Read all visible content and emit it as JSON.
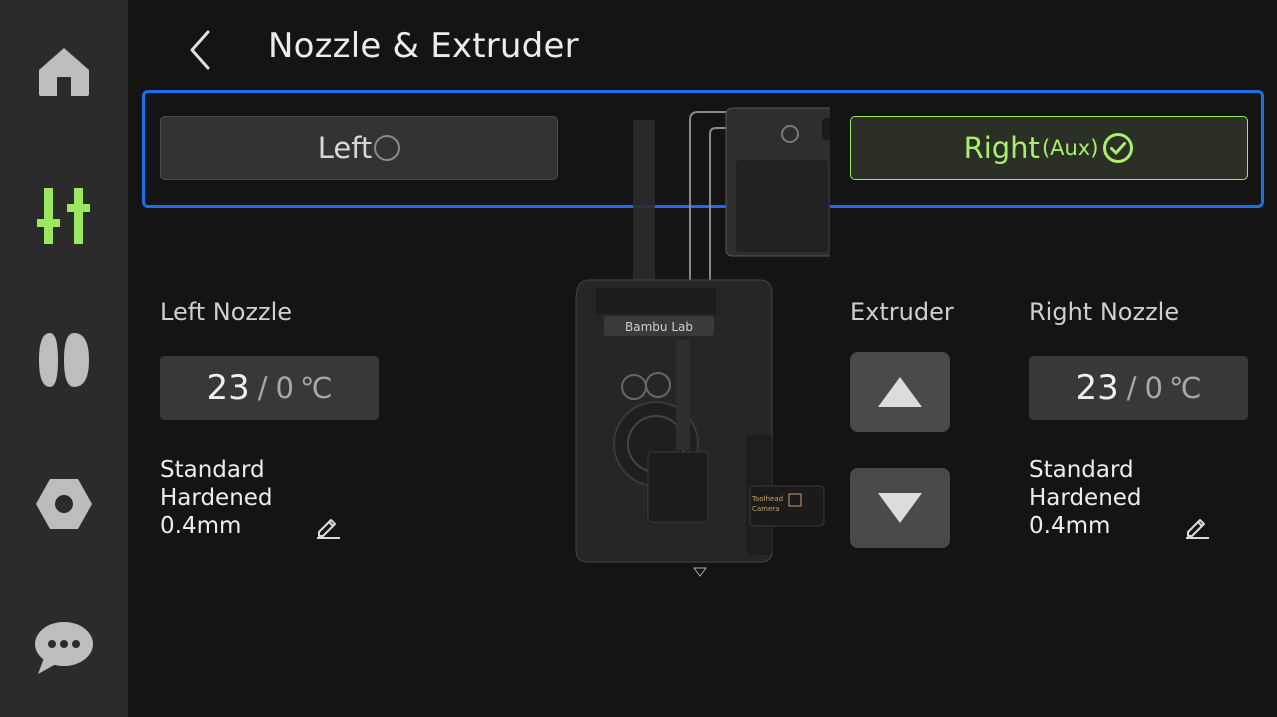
{
  "header": {
    "title": "Nozzle & Extruder"
  },
  "nozzle_select": {
    "left_label": "Left",
    "right_label": "Right",
    "right_suffix": "(Aux)",
    "selected": "right"
  },
  "left_nozzle": {
    "title": "Left Nozzle",
    "current_temp": "23",
    "separator": "/",
    "target_temp": "0",
    "unit": "℃",
    "line1": "Standard",
    "line2": "Hardened",
    "line3": "0.4mm"
  },
  "extruder": {
    "title": "Extruder"
  },
  "right_nozzle": {
    "title": "Right Nozzle",
    "current_temp": "23",
    "separator": "/",
    "target_temp": "0",
    "unit": "℃",
    "line1": "Standard",
    "line2": "Hardened",
    "line3": "0.4mm"
  },
  "illustration": {
    "brand_text": "Bambu Lab",
    "camera_line1": "Toolhead",
    "camera_line2": "Camera"
  },
  "colors": {
    "accent": "#9be860",
    "focus": "#1a6eea",
    "sidebar": "#2b2b2b",
    "background": "#141414"
  },
  "sidebar": {
    "items": [
      {
        "icon": "home-icon",
        "active": false
      },
      {
        "icon": "controls-icon",
        "active": true
      },
      {
        "icon": "filament-spool-icon",
        "active": false
      },
      {
        "icon": "settings-hex-icon",
        "active": false
      },
      {
        "icon": "chat-icon",
        "active": false
      }
    ]
  }
}
